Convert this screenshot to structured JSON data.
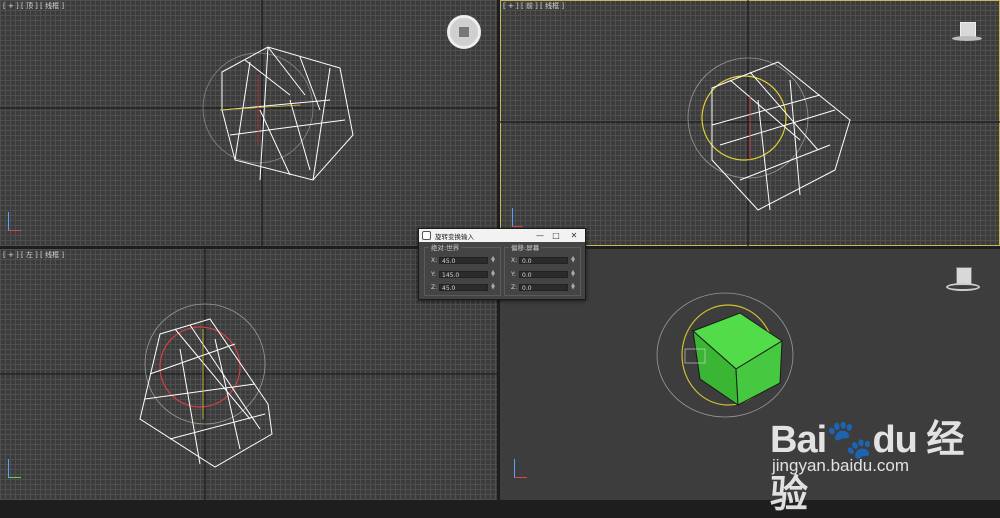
{
  "viewports": {
    "top": {
      "label": "[ + ] [ 顶 ] [ 线框 ]"
    },
    "front": {
      "label": "[ + ] [ 前 ] [ 线框 ]"
    },
    "left": {
      "label": "[ + ] [ 左 ] [ 线框 ]"
    },
    "perspective": {
      "label": ""
    }
  },
  "dialog": {
    "title": "旋转变换输入",
    "minimize": "—",
    "maximize": "□",
    "close": "✕",
    "absolute": {
      "title": "绝对:世界",
      "x_label": "X:",
      "x_value": "45.0",
      "y_label": "Y:",
      "y_value": "145.0",
      "z_label": "Z:",
      "z_value": "45.0"
    },
    "offset": {
      "title": "偏移:屏幕",
      "x_label": "X:",
      "x_value": "0.0",
      "y_label": "Y:",
      "y_value": "0.0",
      "z_label": "Z:",
      "z_value": "0.0"
    }
  },
  "watermark": {
    "logo_text": "Bai🐾du 经验",
    "url": "jingyan.baidu.com"
  },
  "colors": {
    "viewport_bg": "#3c3c3c",
    "grid_line": "#4f4f4f",
    "active_border": "#c8b85a",
    "cube_green": "#3fd13a"
  },
  "icons": [
    "viewcube-icon",
    "axis-tripod-icon",
    "dialog-app-icon",
    "spinner-icon"
  ]
}
